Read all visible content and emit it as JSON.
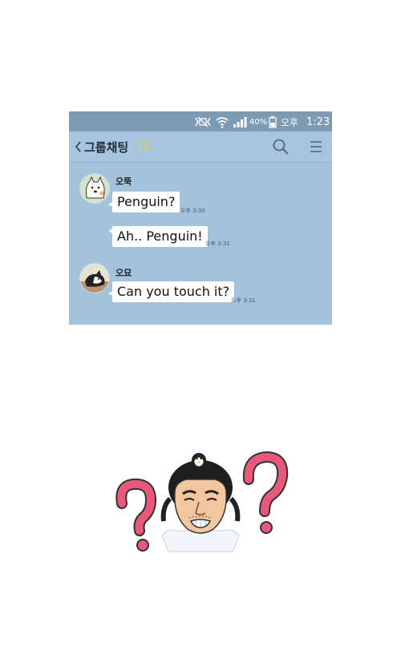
{
  "statusbar": {
    "battery": "40%",
    "ampm": "오후",
    "time": "1:23"
  },
  "header": {
    "title": "그룹채팅",
    "member_count": "11",
    "icons": [
      "chevron-left-icon",
      "search-icon",
      "menu-icon"
    ]
  },
  "messages": [
    {
      "sender": "오뚝",
      "text": "Penguin?",
      "time": "오후 3:30"
    },
    {
      "text": "Ah.. Penguin!",
      "time": "오후 3:31"
    },
    {
      "sender": "오묘",
      "text": "Can you touch it?",
      "time": "오후 3:31"
    }
  ],
  "colors": {
    "chat_background": "#a3c2dc",
    "status_bar": "#7e9bb5",
    "member_count": "#f0cf3a",
    "question_mark": "#e8587a"
  }
}
